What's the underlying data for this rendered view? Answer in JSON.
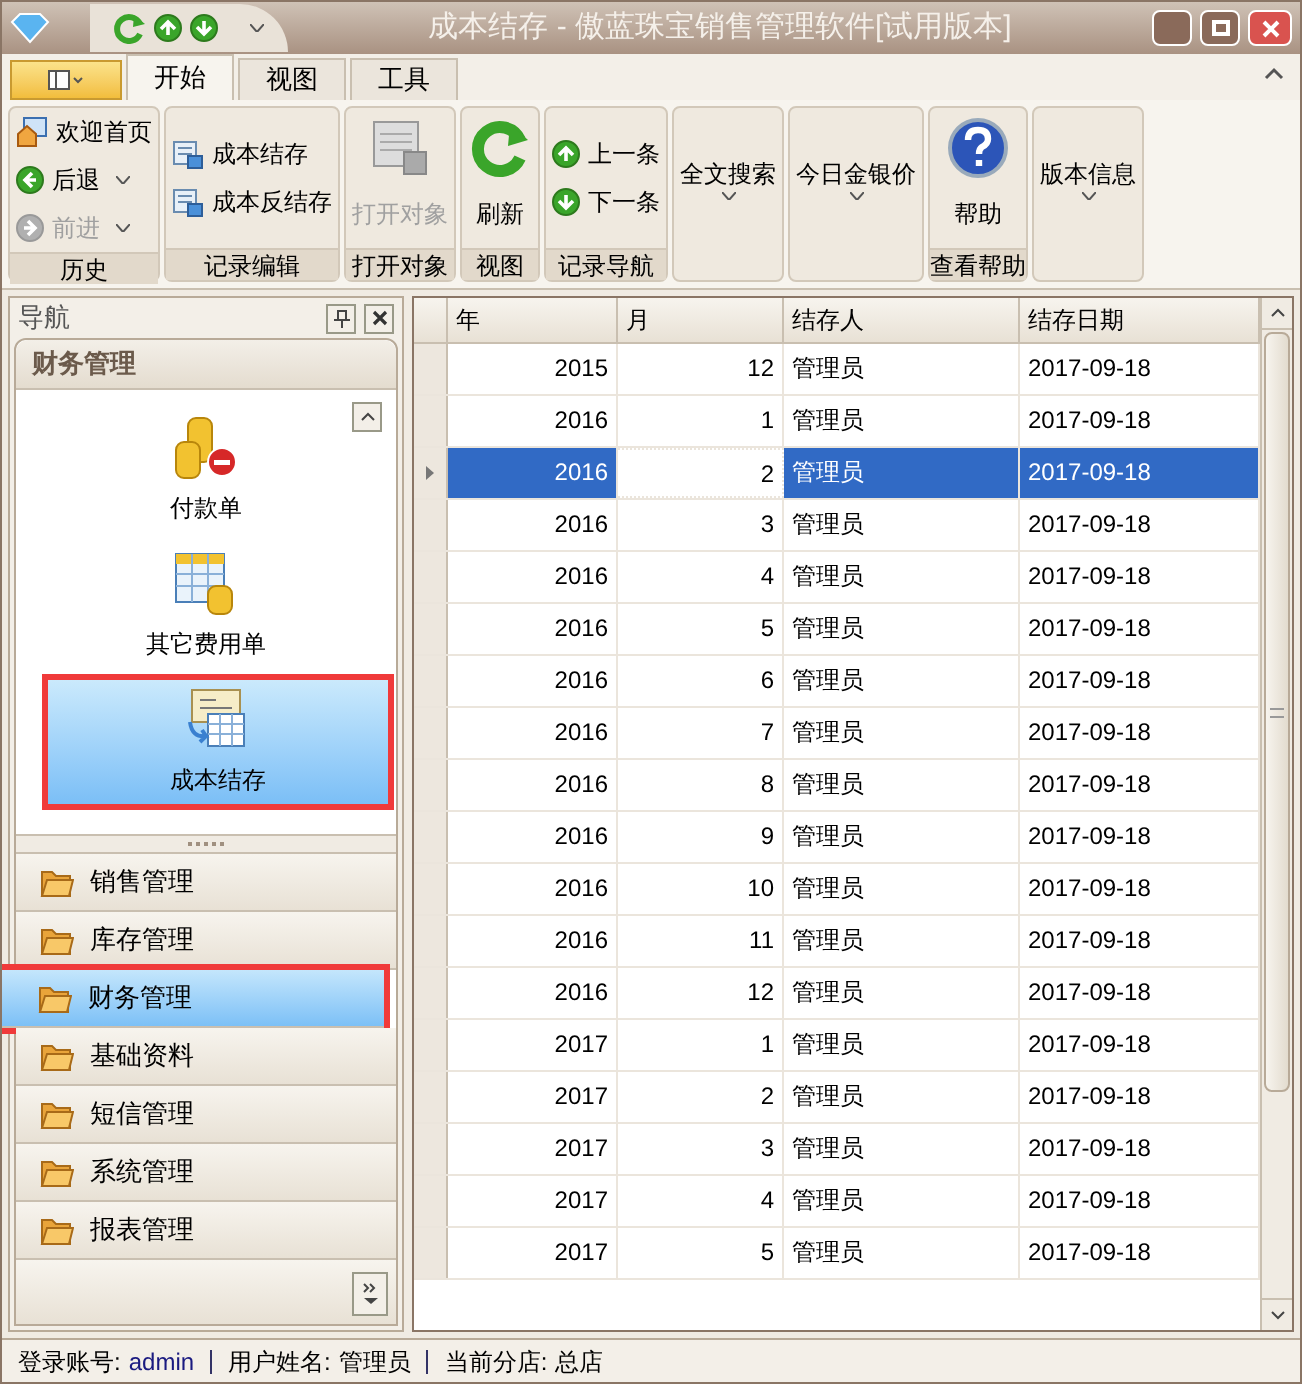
{
  "window": {
    "title": "成本结存 - 傲蓝珠宝销售管理软件[试用版本]"
  },
  "ribbon": {
    "tabs": [
      {
        "label": "开始",
        "selected": true
      },
      {
        "label": "视图",
        "selected": false
      },
      {
        "label": "工具",
        "selected": false
      }
    ],
    "groups": [
      {
        "label": "历史",
        "items": [
          {
            "kind": "small",
            "label": "欢迎首页",
            "disabled": false,
            "dropdown": false
          },
          {
            "kind": "small",
            "label": "后退",
            "disabled": false,
            "dropdown": true
          },
          {
            "kind": "small",
            "label": "前进",
            "disabled": true,
            "dropdown": true
          }
        ]
      },
      {
        "label": "记录编辑",
        "items": [
          {
            "kind": "small",
            "label": "成本结存",
            "disabled": false,
            "dropdown": false
          },
          {
            "kind": "small",
            "label": "成本反结存",
            "disabled": false,
            "dropdown": false
          }
        ]
      },
      {
        "label": "打开对象",
        "items": [
          {
            "kind": "large",
            "label": "打开对象",
            "disabled": true,
            "dropdown": false
          }
        ]
      },
      {
        "label": "视图",
        "items": [
          {
            "kind": "large",
            "label": "刷新",
            "disabled": false,
            "dropdown": false
          }
        ]
      },
      {
        "label": "记录导航",
        "items": [
          {
            "kind": "small",
            "label": "上一条",
            "disabled": false,
            "dropdown": false
          },
          {
            "kind": "small",
            "label": "下一条",
            "disabled": false,
            "dropdown": false
          }
        ]
      },
      {
        "items": [
          {
            "kind": "text",
            "label": "全文搜索",
            "disabled": false,
            "dropdown": true
          }
        ]
      },
      {
        "items": [
          {
            "kind": "text",
            "label": "今日金银价",
            "disabled": false,
            "dropdown": true
          }
        ]
      },
      {
        "label": "查看帮助",
        "items": [
          {
            "kind": "large",
            "label": "帮助",
            "disabled": false,
            "dropdown": false
          }
        ]
      },
      {
        "items": [
          {
            "kind": "text",
            "label": "版本信息",
            "disabled": false,
            "dropdown": true
          }
        ]
      }
    ]
  },
  "navigation": {
    "title": "导航",
    "group_title": "财务管理",
    "items": [
      {
        "label": "付款单",
        "selected": false,
        "marked": false
      },
      {
        "label": "其它费用单",
        "selected": false,
        "marked": false
      },
      {
        "label": "成本结存",
        "selected": true,
        "marked": true
      }
    ],
    "groups": [
      {
        "label": "销售管理",
        "selected": false,
        "marked": false
      },
      {
        "label": "库存管理",
        "selected": false,
        "marked": false
      },
      {
        "label": "财务管理",
        "selected": true,
        "marked": true
      },
      {
        "label": "基础资料",
        "selected": false,
        "marked": false
      },
      {
        "label": "短信管理",
        "selected": false,
        "marked": false
      },
      {
        "label": "系统管理",
        "selected": false,
        "marked": false
      },
      {
        "label": "报表管理",
        "selected": false,
        "marked": false
      }
    ]
  },
  "table": {
    "columns": [
      "年",
      "月",
      "结存人",
      "结存日期"
    ],
    "rows": [
      {
        "cells": [
          "2015",
          "12",
          "管理员",
          "2017-09-18"
        ],
        "selected": false
      },
      {
        "cells": [
          "2016",
          "1",
          "管理员",
          "2017-09-18"
        ],
        "selected": false
      },
      {
        "cells": [
          "2016",
          "2",
          "管理员",
          "2017-09-18"
        ],
        "selected": true
      },
      {
        "cells": [
          "2016",
          "3",
          "管理员",
          "2017-09-18"
        ],
        "selected": false
      },
      {
        "cells": [
          "2016",
          "4",
          "管理员",
          "2017-09-18"
        ],
        "selected": false
      },
      {
        "cells": [
          "2016",
          "5",
          "管理员",
          "2017-09-18"
        ],
        "selected": false
      },
      {
        "cells": [
          "2016",
          "6",
          "管理员",
          "2017-09-18"
        ],
        "selected": false
      },
      {
        "cells": [
          "2016",
          "7",
          "管理员",
          "2017-09-18"
        ],
        "selected": false
      },
      {
        "cells": [
          "2016",
          "8",
          "管理员",
          "2017-09-18"
        ],
        "selected": false
      },
      {
        "cells": [
          "2016",
          "9",
          "管理员",
          "2017-09-18"
        ],
        "selected": false
      },
      {
        "cells": [
          "2016",
          "10",
          "管理员",
          "2017-09-18"
        ],
        "selected": false
      },
      {
        "cells": [
          "2016",
          "11",
          "管理员",
          "2017-09-18"
        ],
        "selected": false
      },
      {
        "cells": [
          "2016",
          "12",
          "管理员",
          "2017-09-18"
        ],
        "selected": false
      },
      {
        "cells": [
          "2017",
          "1",
          "管理员",
          "2017-09-18"
        ],
        "selected": false
      },
      {
        "cells": [
          "2017",
          "2",
          "管理员",
          "2017-09-18"
        ],
        "selected": false
      },
      {
        "cells": [
          "2017",
          "3",
          "管理员",
          "2017-09-18"
        ],
        "selected": false
      },
      {
        "cells": [
          "2017",
          "4",
          "管理员",
          "2017-09-18"
        ],
        "selected": false
      },
      {
        "cells": [
          "2017",
          "5",
          "管理员",
          "2017-09-18"
        ],
        "selected": false
      }
    ]
  },
  "status_bar": [
    {
      "label": "登录账号:",
      "value": "admin"
    },
    {
      "label": "用户姓名:",
      "value": "管理员"
    },
    {
      "label": "当前分店:",
      "value": "总店"
    }
  ]
}
